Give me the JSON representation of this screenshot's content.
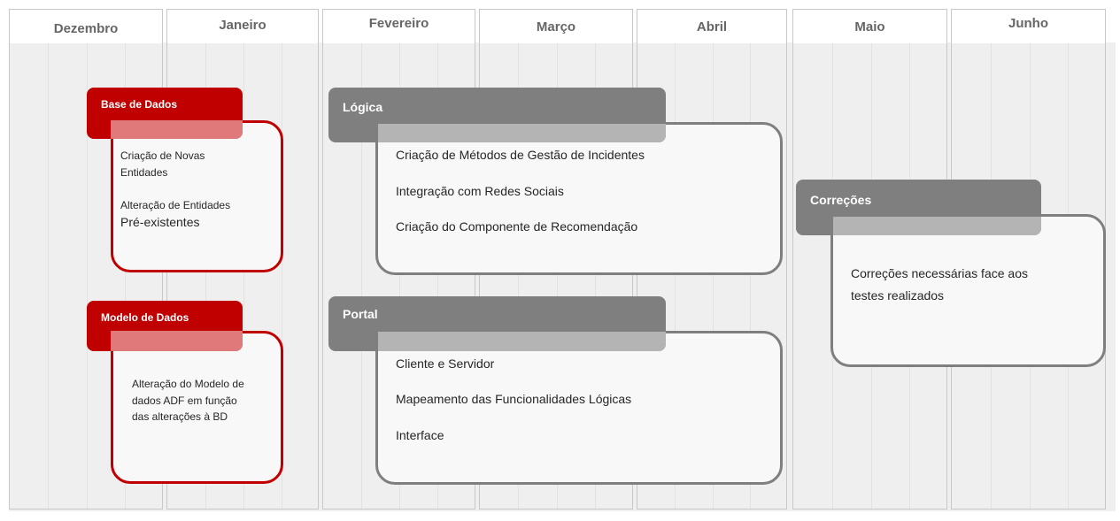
{
  "months": [
    "Dezembro",
    "Janeiro",
    "Fevereiro",
    "Março",
    "Abril",
    "Maio",
    "Junho"
  ],
  "blocks": [
    {
      "id": "base-de-dados",
      "title": "Base de Dados",
      "color": "#c00000",
      "items": [
        "Criação de Novas",
        "Entidades",
        "Alteração de Entidades",
        "Pré-existentes"
      ]
    },
    {
      "id": "modelo-de-dados",
      "title": "Modelo de Dados",
      "color": "#c00000",
      "items": [
        "Alteração do Modelo de",
        "dados ADF em função",
        "das alterações à BD"
      ]
    },
    {
      "id": "logica",
      "title": "Lógica",
      "color": "#7f7f7f",
      "items": [
        "Criação de Métodos de Gestão de Incidentes",
        "Integração com Redes Sociais",
        "Criação do Componente  de Recomendação"
      ]
    },
    {
      "id": "portal",
      "title": "Portal",
      "color": "#7f7f7f",
      "items": [
        "Cliente e Servidor",
        "Mapeamento das Funcionalidades Lógicas",
        "Interface"
      ]
    },
    {
      "id": "correcoes",
      "title": "Correções",
      "color": "#7f7f7f",
      "items": [
        "Correções necessárias face aos",
        "testes realizados"
      ]
    }
  ]
}
